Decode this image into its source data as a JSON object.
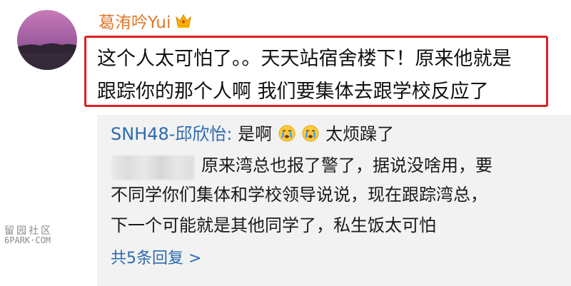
{
  "post": {
    "username": "葛洧吟Yui",
    "comment_line1": "这个人太可怕了。。天天站宿舍楼下！原来他就是",
    "comment_line2": "跟踪你的那个人啊 我们要集体去跟学校反应了"
  },
  "reply": {
    "author": "SNH48-邱欣怡:",
    "text_before_emoji": "是啊",
    "text_after_emoji": "太烦躁了",
    "line2": "原来湾总也报了警了，据说没啥用，要",
    "line3": "不同学你们集体和学校领导说说，现在跟踪湾总，",
    "line4": "下一个可能就是其他同学了，私生饭太可怕",
    "more_replies": "共5条回复 >"
  },
  "watermark": {
    "top": "留园社区",
    "bottom": "6PARK·COM"
  },
  "colors": {
    "username": "#e0772a",
    "highlight_border": "#e22020",
    "reply_author": "#2d6ab0",
    "link": "#2d6ab0",
    "reply_bg": "#f2f2f2"
  }
}
